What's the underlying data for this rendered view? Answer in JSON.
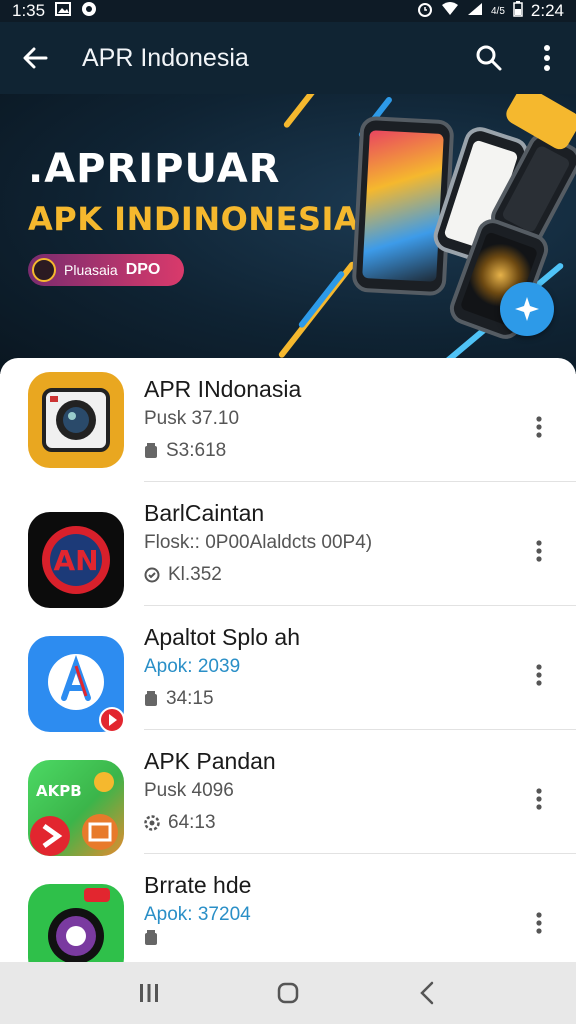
{
  "status_bar": {
    "time_left": "1:35",
    "time_right": "2:24",
    "signal_text": "4/5"
  },
  "app_bar": {
    "title": "APR Indonesia",
    "back_icon": "arrow-left-icon",
    "search_icon": "search-icon",
    "more_icon": "more-vert-icon"
  },
  "banner": {
    "headline": ".APRIPUAR",
    "subheadline": "APK INDINONESIA",
    "badge_label": "Pluasaia",
    "badge_code": "DPO",
    "colors": {
      "accent": "#f5b82e",
      "badge": "#d93a6b",
      "fab": "#2d9ae8"
    }
  },
  "apps": [
    {
      "name": "APR INdonasia",
      "version": "Pusk 37.10",
      "version_color": "#555555",
      "size_icon": "storage-icon",
      "size": "S3:618"
    },
    {
      "name": "BarlCaintan",
      "version": "Flosk:: 0P00Alaldcts 00P4)",
      "version_color": "#555555",
      "size_icon": "check-circle-icon",
      "size": "Kl.352"
    },
    {
      "name": "Apaltot Splo ah",
      "version": "Apok: 2039",
      "version_color": "#2a8fc7",
      "size_icon": "storage-icon",
      "size": "34:15"
    },
    {
      "name": "APK Pandan",
      "version": "Pusk 4096",
      "version_color": "#d03a3a",
      "size_icon": "settings-icon",
      "size": "64:13"
    },
    {
      "name": "Brrate hde",
      "version": "Apok: 37204",
      "version_color": "#2a8fc7",
      "size_icon": "storage-icon",
      "size": ""
    }
  ],
  "nav": {
    "recents_icon": "recents-icon",
    "home_icon": "home-icon",
    "back_icon": "nav-back-icon"
  }
}
